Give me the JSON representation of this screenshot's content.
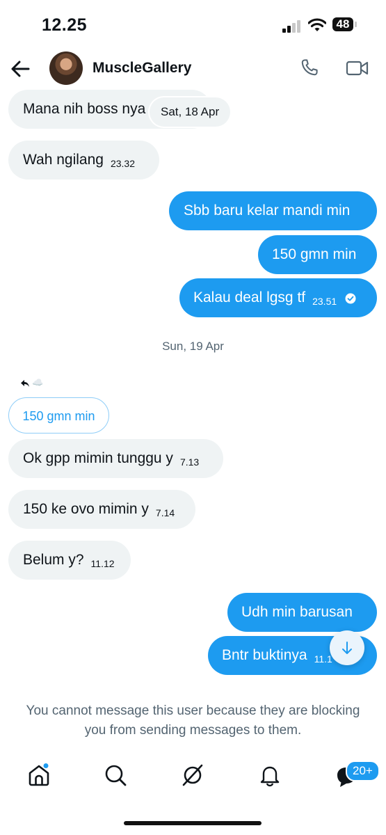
{
  "status_bar": {
    "time": "12.25",
    "battery": "48"
  },
  "header": {
    "name": "MuscleGallery"
  },
  "messages": [
    {
      "text": "Mana nih boss nya",
      "time": ""
    },
    {
      "text": "Wah ngilang",
      "time": "23.32"
    },
    {
      "text": "Sbb baru kelar mandi min",
      "time": ""
    },
    {
      "text": "150 gmn min",
      "time": ""
    },
    {
      "text": "Kalau deal lgsg tf",
      "time": "23.51"
    },
    {
      "text": "Ok gpp mimin tunggu y",
      "time": "7.13"
    },
    {
      "text": "150 ke ovo mimin y",
      "time": "7.14"
    },
    {
      "text": "Belum y?",
      "time": "11.12"
    },
    {
      "text": "Udh min barusan",
      "time": ""
    },
    {
      "text": "Bntr buktinya",
      "time": "11.1"
    }
  ],
  "date_separators": {
    "sticky": "Sat, 18 Apr",
    "second": "Sun, 19 Apr"
  },
  "reply_preview": {
    "text": "150 gmn min",
    "reaction": "☁️"
  },
  "notice": "You cannot message this user because they are blocking you from sending messages to them.",
  "nav": {
    "badge": "20+"
  }
}
